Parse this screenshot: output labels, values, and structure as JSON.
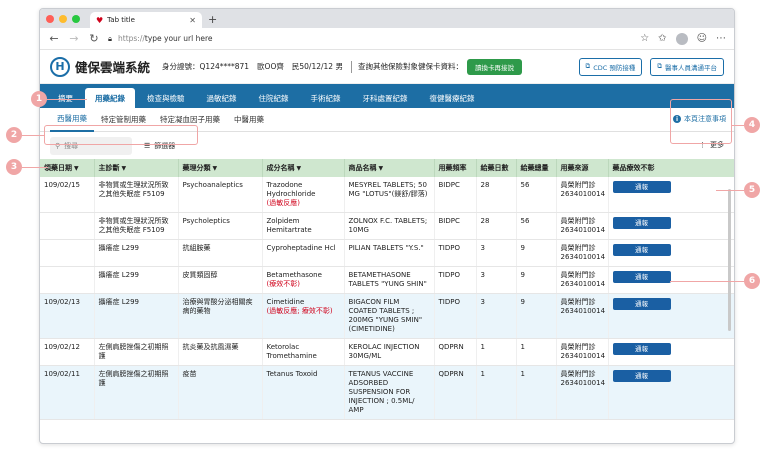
{
  "browser": {
    "tab_title": "Tab title",
    "url_scheme": "https://",
    "url_text": "type your url here",
    "traffic_colors": [
      "#ff5f57",
      "#febc2e",
      "#28c840"
    ]
  },
  "header": {
    "app_title": "健保雲端系統",
    "patient_id": "身分證號：Q124****871",
    "patient_name": "歐OO齊",
    "patient_birth": "民50/12/12 男",
    "query_text": "查詢其他保險對象健保卡資料：",
    "card_button": "讀換卡再接說",
    "cdc_button": "CDC 預防接種",
    "channel_button": "醫事人員溝通平台"
  },
  "main_tabs": [
    "摘要",
    "用藥紀錄",
    "檢查與檢驗",
    "過敏紀錄",
    "住院紀錄",
    "手術紀錄",
    "牙科處置紀錄",
    "復健醫療紀錄"
  ],
  "sub_tabs": [
    "西醫用藥",
    "特定管制用藥",
    "特定凝血因子用藥",
    "中醫用藥"
  ],
  "notice_label": "本頁注意事項",
  "toolbar": {
    "search_placeholder": "搜尋",
    "filter_label": "篩選器",
    "more_label": "更多"
  },
  "columns": [
    "領藥日期",
    "主診斷",
    "藥理分類",
    "成分名稱",
    "商品名稱",
    "用藥頻率",
    "給藥日數",
    "給藥總量",
    "用藥來源",
    "藥品療效不彰"
  ],
  "rows": [
    {
      "date": "109/02/15",
      "diagnosis": "非物質或生理狀況所致之其他失眠症 F5109",
      "category": "Psychoanaleptics",
      "ingredient": "Trazodone Hydrochloride",
      "note": "(過敏反應)",
      "product": "MESYREL TABLETS; 50 MG \"LOTUS\"(鎂舒/膠落)",
      "freq": "BIDPC",
      "days": "28",
      "total": "56",
      "source": "員榮附門診 2634010014",
      "action": "通報",
      "alt": false
    },
    {
      "date": "",
      "diagnosis": "非物質或生理狀況所致之其他失眠症 F5109",
      "category": "Psycholeptics",
      "ingredient": "Zolpidem Hemitartrate",
      "note": "",
      "product": "ZOLNOX F.C. TABLETS; 10MG",
      "freq": "BIDPC",
      "days": "28",
      "total": "56",
      "source": "員榮附門診 2634010014",
      "action": "通報",
      "alt": false
    },
    {
      "date": "",
      "diagnosis": "攝癢症 L299",
      "category": "抗組胺藥",
      "ingredient": "Cyproheptadine Hcl",
      "note": "",
      "product": "PILIAN TABLETS \"Y.S.\"",
      "freq": "TIDPO",
      "days": "3",
      "total": "9",
      "source": "員榮附門診 2634010014",
      "action": "通報",
      "alt": false
    },
    {
      "date": "",
      "diagnosis": "攝癢症 L299",
      "category": "皮質類固醇",
      "ingredient": "Betamethasone",
      "note": "(療效不彰)",
      "product": "BETAMETHASONE TABLETS \"YUNG SHIN\"",
      "freq": "TIDPO",
      "days": "3",
      "total": "9",
      "source": "員榮附門診 2634010014",
      "action": "通報",
      "alt": false
    },
    {
      "date": "109/02/13",
      "diagnosis": "攝癢症 L299",
      "category": "治療與胃酸分泌相關疾病的藥物",
      "ingredient": "Cimetidine",
      "note": "(過敏反應; 療效不彰)",
      "product": "BIGACON FILM COATED TABLETS ; 200MG \"YUNG SMIN\"(CIMETIDINE)",
      "freq": "TIDPO",
      "days": "3",
      "total": "9",
      "source": "員榮附門診 2634010014",
      "action": "通報",
      "alt": true
    },
    {
      "date": "109/02/12",
      "diagnosis": "左側肩膀挫傷之初期照護",
      "category": "抗炎藥及抗風濕藥",
      "ingredient": "Ketorolac Tromethamine",
      "note": "",
      "product": "KEROLAC INJECTION 30MG/ML",
      "freq": "QDPRN",
      "days": "1",
      "total": "1",
      "source": "員榮附門診 2634010014",
      "action": "通報",
      "alt": false
    },
    {
      "date": "109/02/11",
      "diagnosis": "左側肩膀挫傷之初期照護",
      "category": "疫苗",
      "ingredient": "Tetanus Toxoid",
      "note": "",
      "product": "TETANUS VACCINE ADSORBED SUSPENSION FOR INJECTION ; 0.5ML/ AMP",
      "freq": "QDPRN",
      "days": "1",
      "total": "1",
      "source": "員榮附門診 2634010014",
      "action": "通報",
      "alt": true
    }
  ],
  "markers": [
    "1",
    "2",
    "3",
    "4",
    "5",
    "6"
  ]
}
